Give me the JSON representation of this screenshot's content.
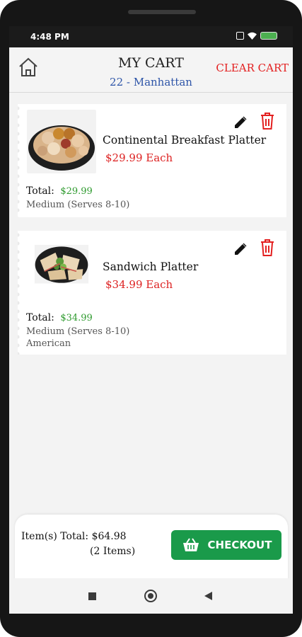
{
  "status": {
    "time": "4:48 PM"
  },
  "header": {
    "title": "MY CART",
    "location": "22 - Manhattan",
    "clear_label": "CLEAR CART"
  },
  "cart": {
    "items": [
      {
        "name": "Continental Breakfast Platter",
        "price": "$29.99 Each",
        "total_label": "Total:",
        "total": "$29.99",
        "options": [
          "Medium (Serves 8-10)"
        ]
      },
      {
        "name": "Sandwich Platter",
        "price": "$34.99 Each",
        "total_label": "Total:",
        "total": "$34.99",
        "options": [
          "Medium (Serves 8-10)",
          "American"
        ]
      }
    ]
  },
  "footer": {
    "items_total": "Item(s) Total: $64.98",
    "items_count": "(2 Items)",
    "checkout_label": "CHECKOUT"
  },
  "icons": {
    "home": "home-icon",
    "edit": "pencil-icon",
    "delete": "trash-icon",
    "checkout": "shopping-basket-icon",
    "nav": [
      "square-recents-icon",
      "circle-home-icon",
      "triangle-back-icon"
    ]
  },
  "colors": {
    "accent_red": "#e32020",
    "location_blue": "#2e55a8",
    "price_green": "#2e9a2e",
    "checkout_green": "#1a9a4a"
  }
}
